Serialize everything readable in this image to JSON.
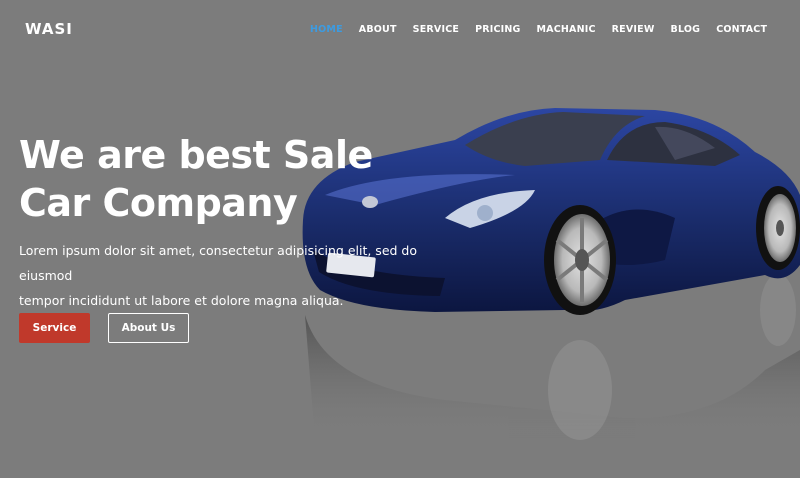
{
  "header": {
    "logo": "WASI",
    "nav": [
      {
        "label": "HOME",
        "active": true
      },
      {
        "label": "ABOUT",
        "active": false
      },
      {
        "label": "SERVICE",
        "active": false
      },
      {
        "label": "PRICING",
        "active": false
      },
      {
        "label": "MACHANIC",
        "active": false
      },
      {
        "label": "REVIEW",
        "active": false
      },
      {
        "label": "BLOG",
        "active": false
      },
      {
        "label": "CONTACT",
        "active": false
      }
    ]
  },
  "hero": {
    "title_line1": "We are best Sale",
    "title_line2": "Car Company",
    "text_line1": "Lorem ipsum dolor sit amet, consectetur adipisicing elit, sed do eiusmod",
    "text_line2": "tempor incididunt ut labore et dolore magna aliqua.",
    "service_button": "Service",
    "about_button": "About Us"
  },
  "colors": {
    "background": "#7c7c7c",
    "accent_active_nav": "#3d9be0",
    "service_button": "#c0392b",
    "car_body": "#1e2f6e"
  },
  "icons": {
    "car_image": "blue-sports-car"
  }
}
